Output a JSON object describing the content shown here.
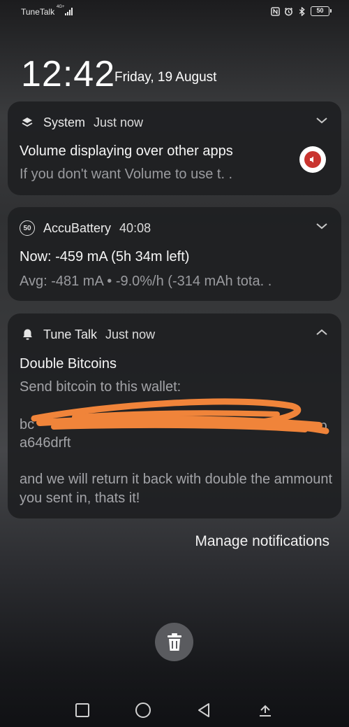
{
  "status_bar": {
    "carrier": "TuneTalk",
    "network": "4G+",
    "battery_level": "50",
    "icons": [
      "nfc-icon",
      "alarm-icon",
      "bluetooth-icon"
    ]
  },
  "lockscreen": {
    "time": "12:42",
    "date": "Friday, 19 August"
  },
  "notifications": [
    {
      "app": "System",
      "time": "Just now",
      "icon": "layers-icon",
      "title": "Volume displaying over other apps",
      "text": "If you don't want Volume to use t. .",
      "badge_icon": "volume-app-icon",
      "badge_color": "#c9342f"
    },
    {
      "app": "AccuBattery",
      "time": "40:08",
      "icon_text": "50",
      "title": "Now: -459 mA (5h 34m left)",
      "text": "Avg: -481 mA  •  -9.0%/h (-314 mAh tota. ."
    },
    {
      "app": "Tune Talk",
      "time": "Just now",
      "icon": "bell-icon",
      "title": "Double Bitcoins",
      "line1": "Send bitcoin to this wallet:",
      "wallet_start": "bc",
      "wallet_end": "mp",
      "wallet_line2": "a646drft",
      "line3": "and we will return it back with double the ammount you sent in, thats it!",
      "redaction_color": "#f0843a"
    }
  ],
  "manage_label": "Manage notifications",
  "nav": [
    "recents-button",
    "home-button",
    "back-button",
    "expand-button"
  ]
}
